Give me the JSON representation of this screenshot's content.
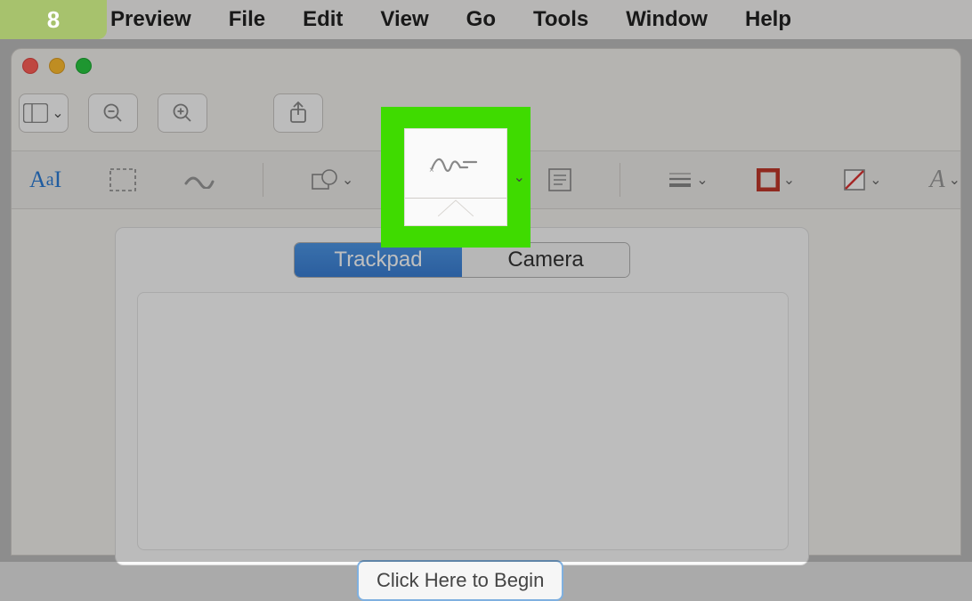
{
  "step_number": "8",
  "menubar": {
    "items": [
      "Preview",
      "File",
      "Edit",
      "View",
      "Go",
      "Tools",
      "Window",
      "Help"
    ]
  },
  "main_toolbar": {
    "sidebar_icon": "sidebar-icon",
    "zoom_out_icon": "zoom-out-icon",
    "zoom_in_icon": "zoom-in-icon",
    "share_icon": "share-icon"
  },
  "format_toolbar": {
    "text_style": "Aa",
    "selection_tool": "selection-rect-icon",
    "sketch_tool": "sketch-icon",
    "shapes_tool": "shapes-icon",
    "text_tool": "text-box-icon",
    "signature_tool": "signature-icon",
    "note_tool": "note-icon",
    "line_width_tool": "line-width-icon",
    "border_color_tool": "border-color-icon",
    "fill_color_tool": "fill-color-icon",
    "font_style_tool": "A"
  },
  "signature_popover": {
    "tabs": [
      "Trackpad",
      "Camera"
    ],
    "selected_tab": 0,
    "begin_button": "Click Here to Begin"
  },
  "colors": {
    "highlight_green": "#3fdb00",
    "selected_blue": "#3a7ed4",
    "border_icon_red": "#c0392b"
  }
}
